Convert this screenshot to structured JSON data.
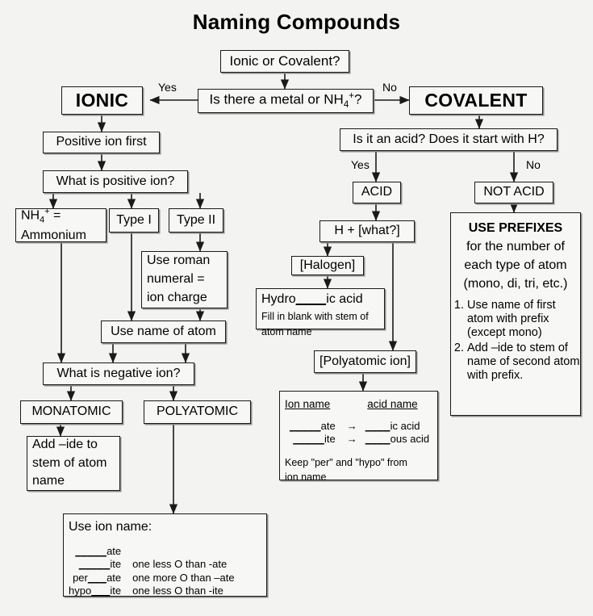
{
  "title": "Naming Compounds",
  "nodes": {
    "start": "Ionic or Covalent?",
    "metal_question": "Is there a metal or NH4+?",
    "metal_question_pre": "Is there a metal or NH",
    "metal_question_sub": "4",
    "metal_question_sup": "+",
    "metal_question_post": "?",
    "ionic": "IONIC",
    "covalent": "COVALENT",
    "positive_ion_first": "Positive ion first",
    "what_is_positive_ion": "What is positive ion?",
    "ammonium_line1_pre": "NH",
    "ammonium_line1_sub": "4",
    "ammonium_line1_sup": "+",
    "ammonium_line1_post": " =",
    "ammonium_line2": "Ammonium",
    "type_i": "Type I",
    "type_ii": "Type II",
    "roman_numeral_l1": "Use roman",
    "roman_numeral_l2": "numeral =",
    "roman_numeral_l3": "ion charge",
    "use_name_of_atom": "Use name of atom",
    "what_is_negative_ion": "What is negative ion?",
    "monatomic": "MONATOMIC",
    "polyatomic": "POLYATOMIC",
    "add_ide_l1": "Add –ide to",
    "add_ide_l2": "stem of atom",
    "add_ide_l3": "name",
    "acid_question": "Is it an acid?   Does it start with H?",
    "acid": "ACID",
    "not_acid": "NOT ACID",
    "h_plus_what": "H  +  [what?]",
    "halogen": "[Halogen]",
    "hydro_title_a": "Hydro",
    "hydro_title_blank": "____",
    "hydro_title_b": "ic acid",
    "hydro_sub1": "Fill in blank with stem of",
    "hydro_sub2": "atom name",
    "polyatomic_ion": "[Polyatomic ion]"
  },
  "edge_labels": {
    "yes_ionic": "Yes",
    "no_covalent": "No",
    "yes_acid": "Yes",
    "no_acid": "No"
  },
  "use_ion_name_box": {
    "heading": "Use ion name:",
    "rows": [
      {
        "left_prefix": "",
        "blank": "_____",
        "suffix": "ate",
        "note": ""
      },
      {
        "left_prefix": "",
        "blank": "_____",
        "suffix": "ite",
        "note": "one less O than -ate"
      },
      {
        "left_prefix": "per",
        "blank": "___",
        "suffix": "ate",
        "note": "one more O than –ate"
      },
      {
        "left_prefix": "hypo",
        "blank": "___",
        "suffix": "ite",
        "note": "one less O than -ite"
      }
    ]
  },
  "acid_name_box": {
    "col1_header": "Ion name",
    "col2_header": "acid name",
    "rows": [
      {
        "ion_blank": "_____",
        "ion_suffix": "ate",
        "arrow": "→",
        "acid_blank": "____",
        "acid_suffix": "ic acid"
      },
      {
        "ion_blank": "_____",
        "ion_suffix": "ite",
        "arrow": "→",
        "acid_blank": "____",
        "acid_suffix": "ous acid"
      }
    ],
    "footer_l1": "Keep \"per\" and \"hypo\" from",
    "footer_l2": "ion name"
  },
  "prefixes_box": {
    "heading": "USE PREFIXES",
    "line1": "for the number of",
    "line2": "each type of atom",
    "line3": "(mono, di, tri, etc.)",
    "steps": [
      "Use name of first atom with prefix (except mono)",
      "Add –ide to stem of name of second atom with prefix."
    ]
  },
  "colors": {
    "background": "#f3f3f1",
    "box_fill": "#f7f7f5",
    "ink": "#1a1a1a",
    "shadow": "#8d8d8d"
  }
}
